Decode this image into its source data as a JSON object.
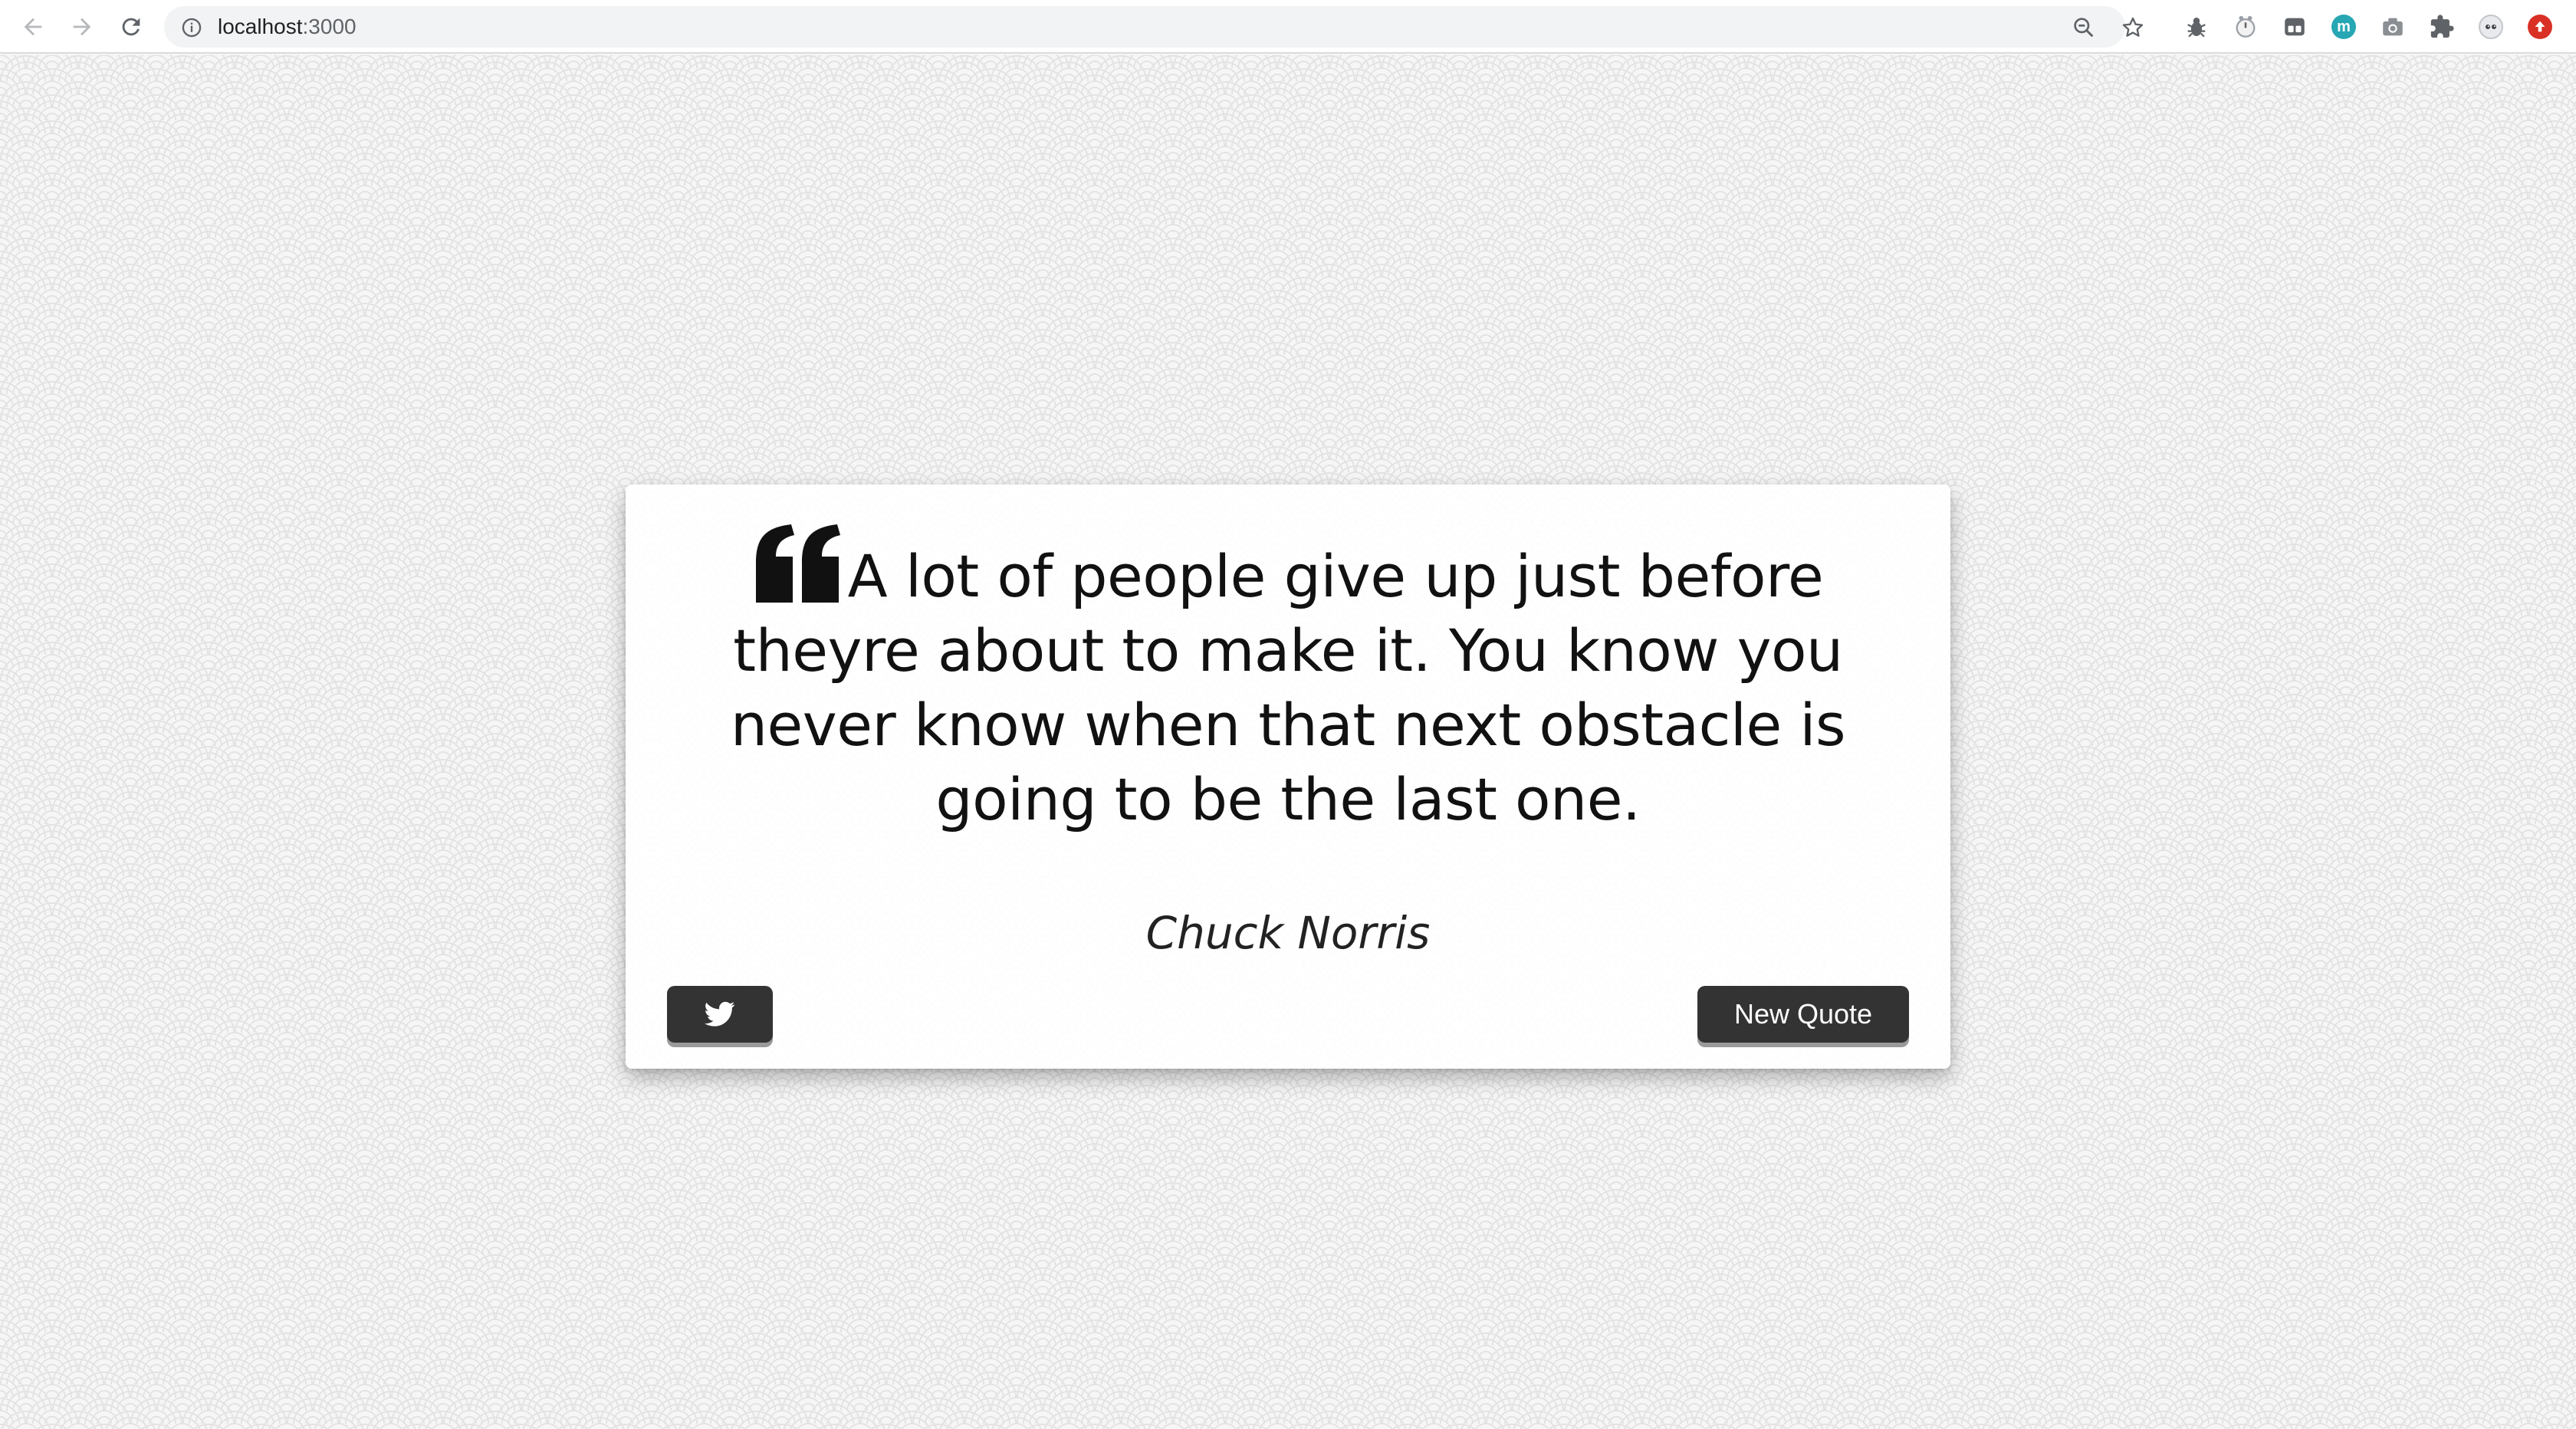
{
  "browser": {
    "url_host": "localhost",
    "url_port": ":3000"
  },
  "quote": {
    "text": "A lot of people give up just before theyre about to make it. You know you never know when that next obstacle is going to be the last one.",
    "author": "Chuck Norris"
  },
  "buttons": {
    "tweet_icon": "twitter-icon",
    "new_quote_label": "New Quote"
  },
  "extensions": [
    {
      "icon": "bug-icon"
    },
    {
      "icon": "timer-icon"
    },
    {
      "icon": "cards-icon"
    },
    {
      "icon": "m-badge-icon",
      "color": "#26a7b3"
    },
    {
      "icon": "camera-icon"
    },
    {
      "icon": "puzzle-icon"
    },
    {
      "icon": "profile-avatar-icon"
    },
    {
      "icon": "update-icon",
      "color": "#d93025"
    }
  ],
  "colors": {
    "button_bg": "#333333",
    "text": "#111111"
  }
}
